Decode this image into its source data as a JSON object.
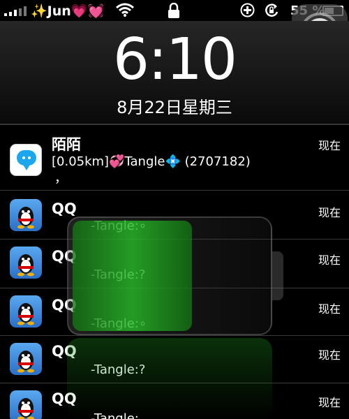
{
  "status_bar": {
    "carrier": "Jun",
    "battery_percent": "55 %",
    "battery_level": 0.55
  },
  "lock_screen": {
    "time": "6:10",
    "date": "8月22日星期三"
  },
  "charging_battery": {
    "level": 0.55,
    "color": "#2ec22e"
  },
  "notifications": [
    {
      "app": "陌陌",
      "icon": "momo-chat-icon",
      "message": "[0.05km]💞Tangle💠 (2707182)",
      "message2": "，",
      "time": "现在"
    },
    {
      "app": "QQ",
      "icon": "qq-penguin-icon",
      "message": "-Tangle:∘",
      "time": "现在"
    },
    {
      "app": "QQ",
      "icon": "qq-penguin-icon",
      "message": "-Tangle:?",
      "time": "现在"
    },
    {
      "app": "QQ",
      "icon": "qq-penguin-icon",
      "message": "-Tangle:∘",
      "time": "现在"
    },
    {
      "app": "QQ",
      "icon": "qq-penguin-icon",
      "message": "-Tangle:?",
      "time": "现在"
    },
    {
      "app": "QQ",
      "icon": "qq-penguin-icon",
      "message": "-Tangle:，",
      "time": "现在"
    }
  ]
}
